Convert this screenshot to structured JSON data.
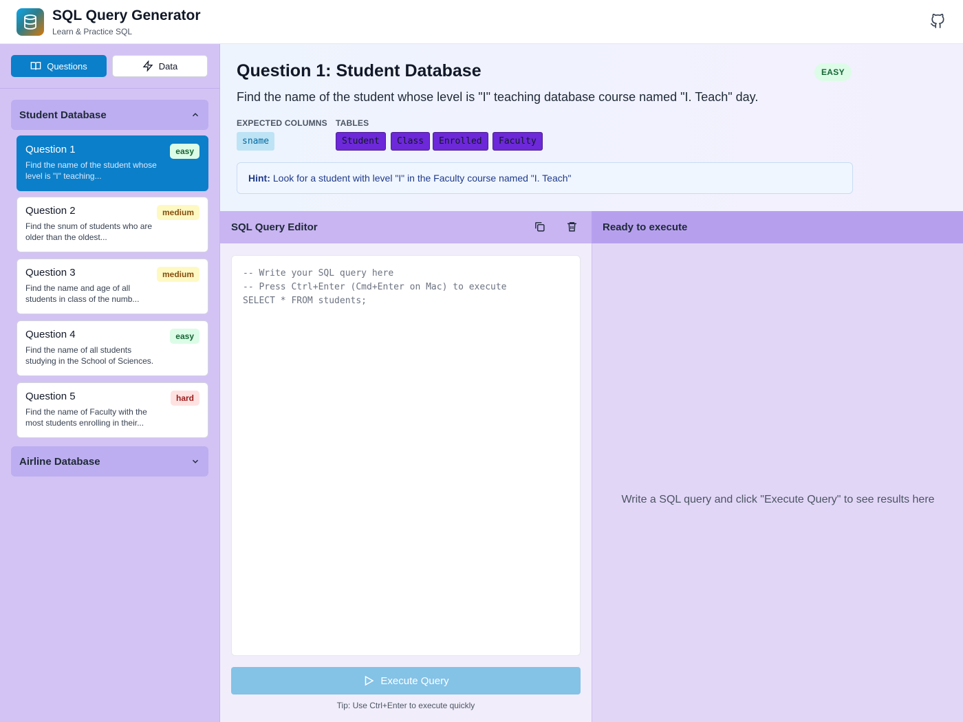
{
  "app": {
    "title": "SQL Query Generator",
    "subtitle": "Learn & Practice SQL"
  },
  "header": {
    "github_icon": "github-icon"
  },
  "sidebar": {
    "tabs": [
      {
        "label": "Questions",
        "icon": "book-icon",
        "active": true
      },
      {
        "label": "Data",
        "icon": "lightning-icon",
        "active": false
      }
    ],
    "groups": [
      {
        "name": "Student Database",
        "expanded": true,
        "questions": [
          {
            "title": "Question 1",
            "desc": "Find the name of the student whose level is \"I\" teaching...",
            "difficulty": "easy",
            "active": true
          },
          {
            "title": "Question 2",
            "desc": "Find the snum of students who are older than the oldest...",
            "difficulty": "medium"
          },
          {
            "title": "Question 3",
            "desc": "Find the name and age of all students in class of the numb...",
            "difficulty": "medium"
          },
          {
            "title": "Question 4",
            "desc": "Find the name of all students studying in the School of Sciences.",
            "difficulty": "easy"
          },
          {
            "title": "Question 5",
            "desc": "Find the name of Faculty with the most students enrolling in their...",
            "difficulty": "hard"
          }
        ]
      },
      {
        "name": "Airline Database",
        "expanded": false
      }
    ]
  },
  "question": {
    "title": "Question 1: Student Database",
    "difficulty": "EASY",
    "description": "Find the name of the student whose level is \"I\" teaching database course named \"I. Teach\" day.",
    "expected_columns_label": "EXPECTED COLUMNS",
    "expected_columns": [
      "sname"
    ],
    "tables_label": "TABLES",
    "tables": [
      "Student",
      "Class",
      "Enrolled",
      "Faculty"
    ],
    "hint_icon": "",
    "hint_label": "Hint:",
    "hint_text": "Look for a student with level \"I\" in the Faculty course named \"I. Teach\""
  },
  "editor": {
    "title": "SQL Query Editor",
    "code": "-- Write your SQL query here\n-- Press Ctrl+Enter (Cmd+Enter on Mac) to execute\nSELECT * FROM students;",
    "execute_label": "Execute Query",
    "tip": " Tip: Use Ctrl+Enter to execute quickly"
  },
  "results": {
    "status": "Ready to execute",
    "empty_icon": "",
    "empty_message": "Write a SQL query and click \"Execute Query\" to see results here"
  },
  "colors": {
    "primary": "#0b7fc9",
    "sidebar_bg": "#d3c3f5",
    "editor_header": "#c8b5f2",
    "results_header": "#b6a0ee",
    "table_chip": "#6d28d9"
  }
}
